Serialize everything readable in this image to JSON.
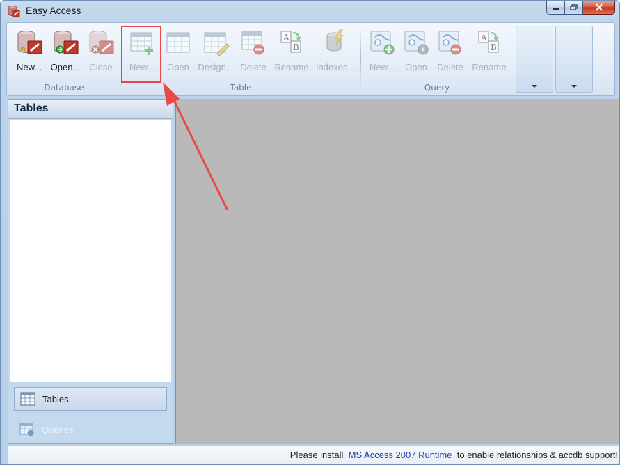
{
  "window": {
    "title": "Easy Access",
    "icon": "app-icon"
  },
  "ribbon": {
    "groups": {
      "database": {
        "label": "Database",
        "buttons": [
          {
            "label": "New...",
            "icon": "database-new-icon",
            "enabled": true
          },
          {
            "label": "Open...",
            "icon": "database-open-icon",
            "enabled": true
          },
          {
            "label": "Close",
            "icon": "database-close-icon",
            "enabled": false
          }
        ]
      },
      "table": {
        "label": "Table",
        "buttons": [
          {
            "label": "New...",
            "icon": "table-new-icon",
            "enabled": false,
            "highlighted": true
          },
          {
            "label": "Open",
            "icon": "table-open-icon",
            "enabled": false
          },
          {
            "label": "Design...",
            "icon": "table-design-icon",
            "enabled": false
          },
          {
            "label": "Delete",
            "icon": "table-delete-icon",
            "enabled": false
          },
          {
            "label": "Rename",
            "icon": "rename-icon",
            "enabled": false
          },
          {
            "label": "Indexes...",
            "icon": "indexes-icon",
            "enabled": false
          }
        ]
      },
      "query": {
        "label": "Query",
        "buttons": [
          {
            "label": "New...",
            "icon": "query-new-icon",
            "enabled": false
          },
          {
            "label": "Open",
            "icon": "query-open-icon",
            "enabled": false
          },
          {
            "label": "Delete",
            "icon": "query-delete-icon",
            "enabled": false
          },
          {
            "label": "Rename",
            "icon": "rename-icon",
            "enabled": false
          }
        ]
      }
    }
  },
  "left_pane": {
    "title": "Tables",
    "nav": [
      {
        "label": "Tables",
        "icon": "table-icon",
        "active": true
      },
      {
        "label": "Queries",
        "icon": "query-icon",
        "active": false
      }
    ]
  },
  "statusbar": {
    "prefix": "Please install",
    "link": "MS Access 2007 Runtime",
    "suffix": "to enable relationships & accdb support!"
  },
  "colors": {
    "highlight": "#e54848",
    "annotation_arrow": "#e84a4a",
    "workspace": "#b9b9b9",
    "link": "#1c3ea8"
  }
}
